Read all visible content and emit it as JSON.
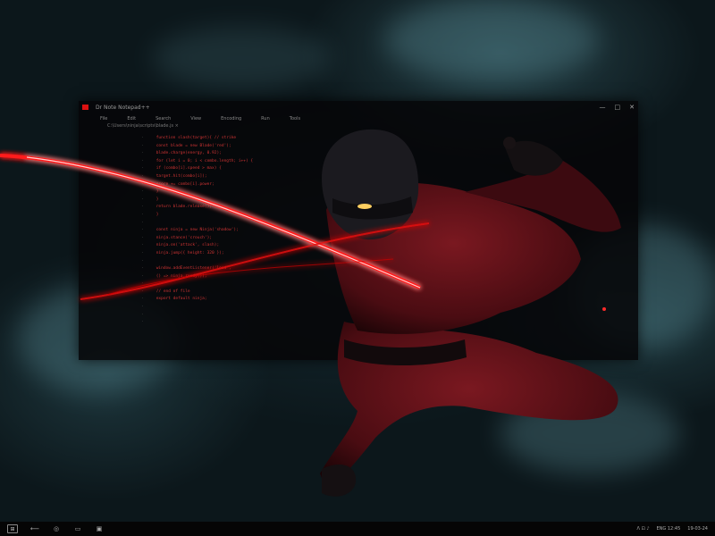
{
  "editor": {
    "title": "Dr   Note   Notepad++",
    "menu": [
      "File",
      "Edit",
      "Search",
      "View",
      "Encoding",
      "Run",
      "Tools"
    ],
    "window_controls": [
      "—",
      "□",
      "✕"
    ],
    "path": "C:\\Users\\ninja\\scripts\\blade.js  ×"
  },
  "code_lines": [
    "   function slash(target){  // strike",
    "     const blade = new Blade('red');",
    "     blade.charge(energy, 0.92);",
    "     for (let i = 0; i < combo.length; i++) {",
    "       if (combo[i].speed > max) {",
    "         target.hit(combo[i]);",
    "         score += combo[i].power;",
    "       }",
    "     }",
    "     return blade.release();",
    "   }",
    "   ",
    "   const ninja = new Ninja('shadow');",
    "   ninja.stance('crouch');",
    "   ninja.on('attack', slash);",
    "   ninja.jump({ height: 320 });",
    "   ",
    "   window.addEventListener('load',",
    "     () => ninja.ready());",
    "   ",
    "   // end of file",
    "   export default ninja;",
    "   ",
    "   ",
    "   "
  ],
  "taskbar": {
    "start": "⊞",
    "icons": [
      "⟵",
      "◎",
      "▭",
      "▣"
    ],
    "tray": [
      "ᐱ  ⊡  ♪",
      "ENG  12:45",
      "19-03-24"
    ]
  },
  "colors": {
    "blade": "#ff1a1a",
    "ninja_suit": "#5a1016",
    "background": "#0c171b",
    "smoke": "#5a8c96"
  }
}
